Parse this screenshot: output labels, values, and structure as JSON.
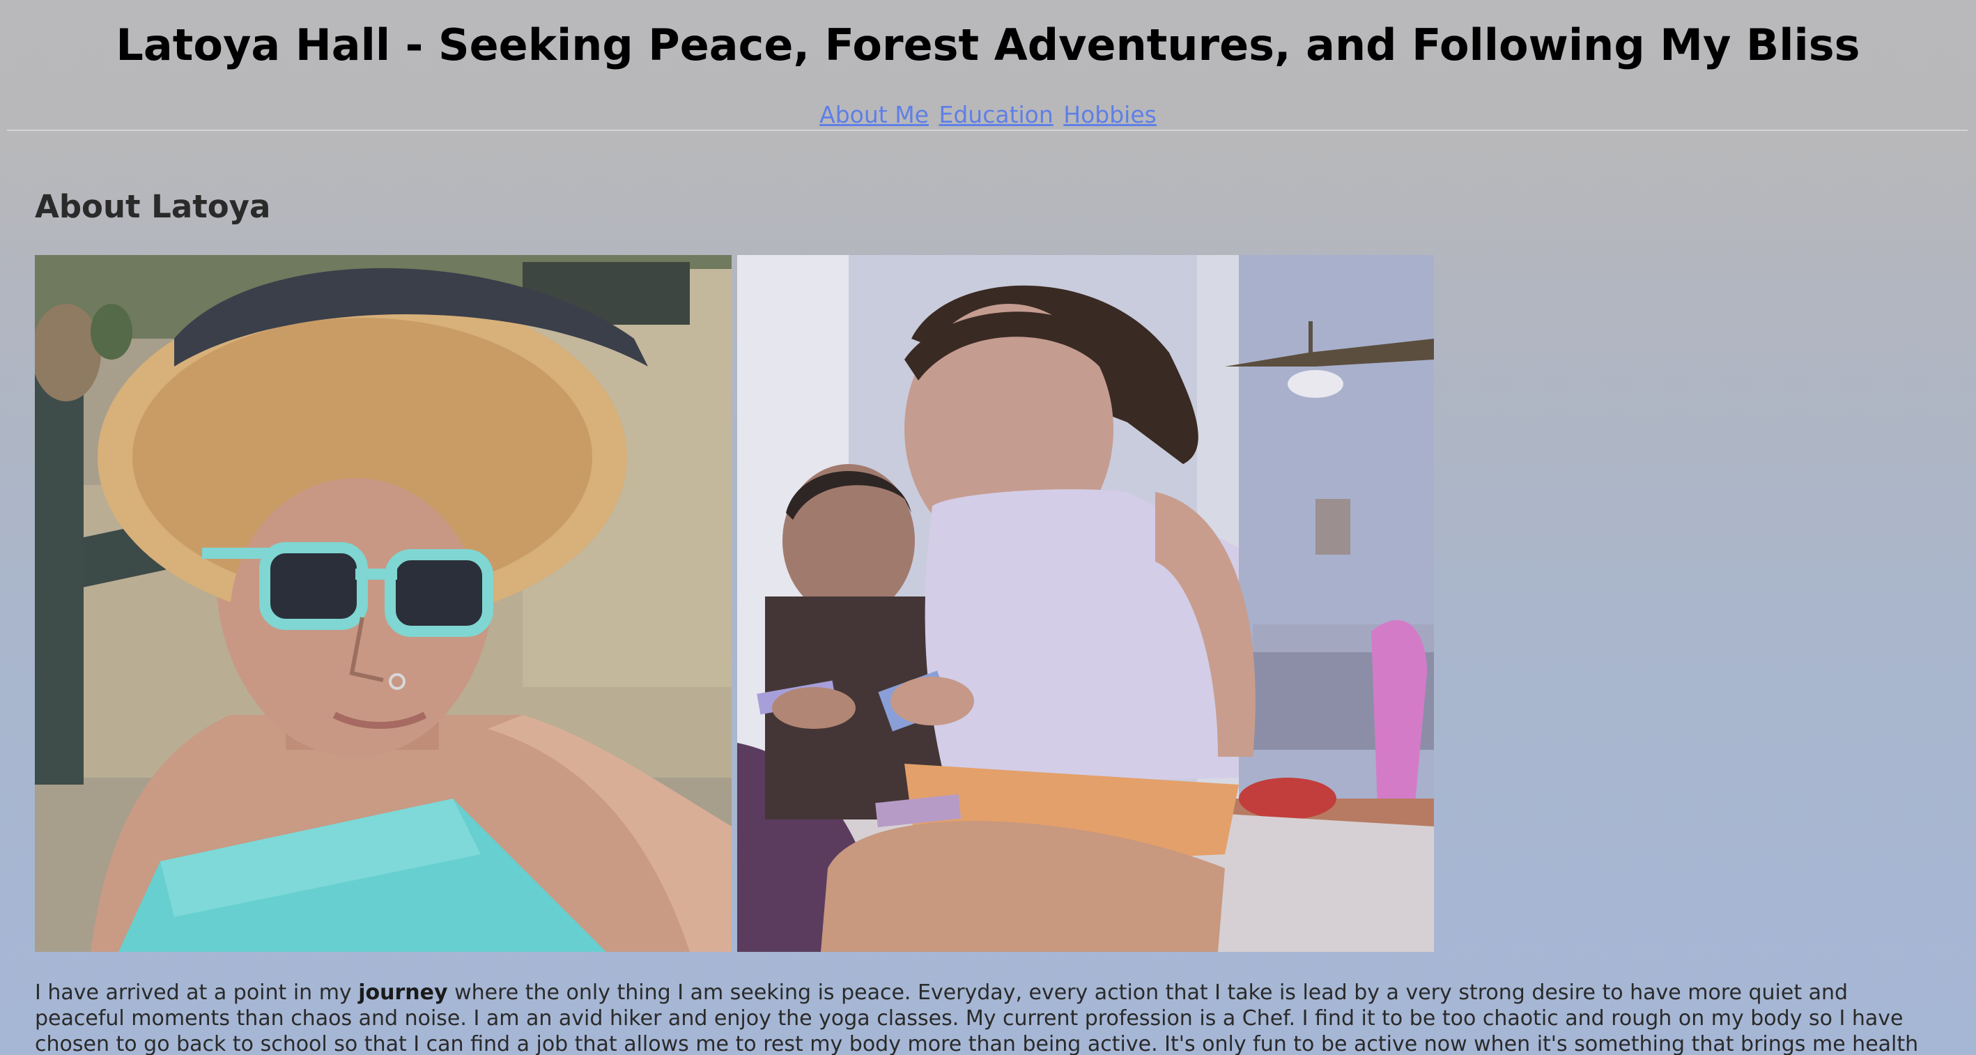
{
  "header": {
    "title": "Latoya Hall - Seeking Peace, Forest Adventures, and Following My Bliss"
  },
  "nav": {
    "links": [
      {
        "label": "About Me"
      },
      {
        "label": "Education"
      },
      {
        "label": "Hobbies"
      }
    ]
  },
  "about": {
    "heading": "About Latoya",
    "photos": [
      {
        "alt": "woman-in-straw-hat-and-sunglasses"
      },
      {
        "alt": "children-playing-with-cards"
      }
    ],
    "text_before": "I have arrived at a point in my ",
    "text_bold": "journey",
    "text_after": " where the only thing I am seeking is peace. Everyday, every action that I take is lead by a very strong desire to have more quiet and peaceful moments than chaos and noise. I am an avid hiker and enjoy the yoga classes. My current profession is a Chef. I find it to be too chaotic and rough on my body so I have chosen to go back to school so that I can find a job that allows me to rest my body more than being active. It's only fun to be active now when it's something that brings me health benefits."
  },
  "colors": {
    "link": "#5f7fe6",
    "title": "#000000",
    "body_text": "#2a2a2a"
  }
}
